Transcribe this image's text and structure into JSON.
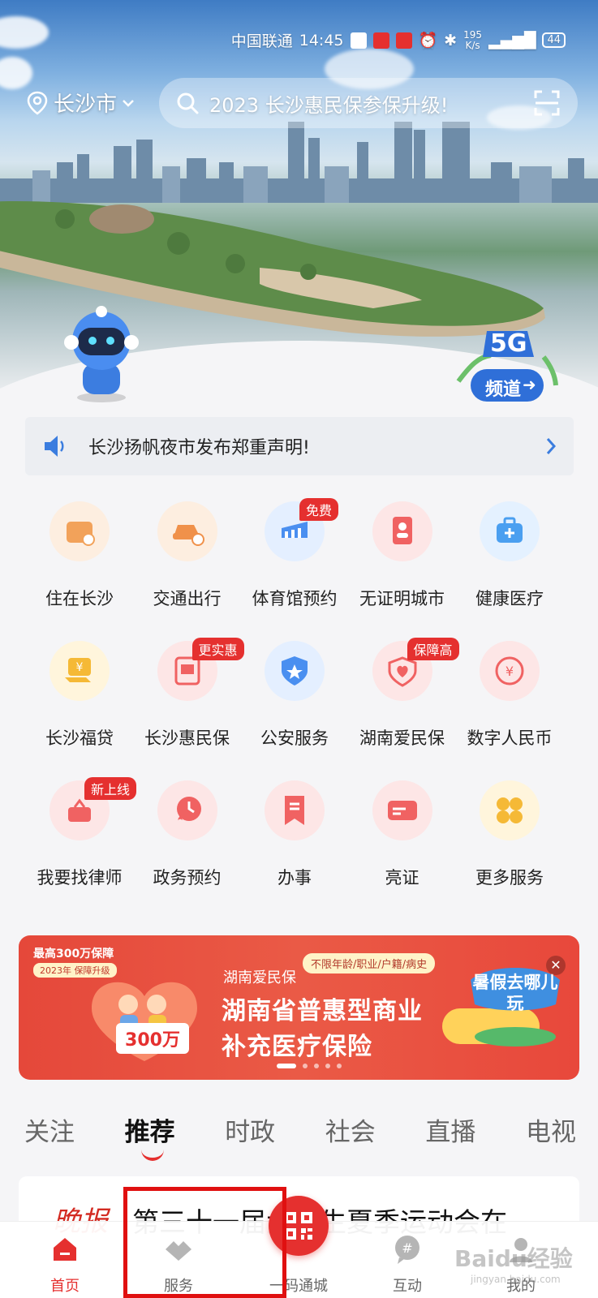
{
  "status_bar": {
    "carrier": "中国联通",
    "time": "14:45",
    "net_speed_value": "195",
    "net_speed_unit": "K/s",
    "battery": "44"
  },
  "header": {
    "city": "长沙市",
    "search_placeholder": "2023 长沙惠民保参保升级!"
  },
  "badge_5g": {
    "title": "5G",
    "label": "频道"
  },
  "notice": {
    "text": "长沙扬帆夜市发布郑重声明!"
  },
  "services": [
    {
      "label": "住在长沙",
      "icon": "house-card-icon",
      "color": "#f2a25a",
      "bg": "#fdeee0"
    },
    {
      "label": "交通出行",
      "icon": "car-icon",
      "color": "#f0914a",
      "bg": "#fdeee0"
    },
    {
      "label": "体育馆预约",
      "icon": "stadium-icon",
      "color": "#4a8ff0",
      "bg": "#e4efff",
      "tag": "免费"
    },
    {
      "label": "无证明城市",
      "icon": "id-card-icon",
      "color": "#f06262",
      "bg": "#fde6e6"
    },
    {
      "label": "健康医疗",
      "icon": "medical-kit-icon",
      "color": "#4a9ff0",
      "bg": "#e4f1ff"
    },
    {
      "label": "长沙福贷",
      "icon": "yuan-card-icon",
      "color": "#f5b936",
      "bg": "#fff5dc"
    },
    {
      "label": "长沙惠民保",
      "icon": "insurance-doc-icon",
      "color": "#f06262",
      "bg": "#fde6e6",
      "tag": "更实惠"
    },
    {
      "label": "公安服务",
      "icon": "police-badge-icon",
      "color": "#4a8ff0",
      "bg": "#e4efff"
    },
    {
      "label": "湖南爱民保",
      "icon": "shield-heart-icon",
      "color": "#f06262",
      "bg": "#fde6e6",
      "tag": "保障高"
    },
    {
      "label": "数字人民币",
      "icon": "digital-yuan-icon",
      "color": "#f06262",
      "bg": "#fde6e6"
    },
    {
      "label": "我要找律师",
      "icon": "lawyer-icon",
      "color": "#f06262",
      "bg": "#fde6e6",
      "tag": "新上线"
    },
    {
      "label": "政务预约",
      "icon": "clock-icon",
      "color": "#f06262",
      "bg": "#fde6e6"
    },
    {
      "label": "办事",
      "icon": "document-icon",
      "color": "#f06262",
      "bg": "#fde6e6"
    },
    {
      "label": "亮证",
      "icon": "license-card-icon",
      "color": "#f06262",
      "bg": "#fde6e6"
    },
    {
      "label": "更多服务",
      "icon": "grid-more-icon",
      "color": "#f5b936",
      "bg": "#fff5dc"
    }
  ],
  "banner": {
    "top_text": "最高300万保障",
    "sub_text": "2023年 保障升级",
    "amount": "300万",
    "org": "湖南爱民保",
    "tagline": "不限年龄/职业/户籍/病史",
    "title_line1": "湖南省普惠型商业",
    "title_line2": "补充医疗保险",
    "float_ad_text": "暑假去哪儿玩",
    "page_count": 5,
    "current_page": 1
  },
  "tabs": [
    "关注",
    "推荐",
    "时政",
    "社会",
    "直播",
    "电视"
  ],
  "active_tab": "推荐",
  "news": {
    "logo": "晚报",
    "title": "第三十一届大学生夏季运动会在"
  },
  "bottom_nav": [
    {
      "label": "首页",
      "icon": "home-icon",
      "active": true
    },
    {
      "label": "服务",
      "icon": "handshake-icon",
      "active": false
    },
    {
      "label": "一码通城",
      "icon": "qr-code-icon",
      "active": false
    },
    {
      "label": "互动",
      "icon": "hashtag-chat-icon",
      "active": false
    },
    {
      "label": "我的",
      "icon": "profile-icon",
      "active": false
    }
  ],
  "watermark": {
    "brand": "Baidu经验",
    "url": "jingyan.baidu.com"
  },
  "colors": {
    "brand_red": "#e5302f",
    "page_bg": "#f5f5f7"
  }
}
